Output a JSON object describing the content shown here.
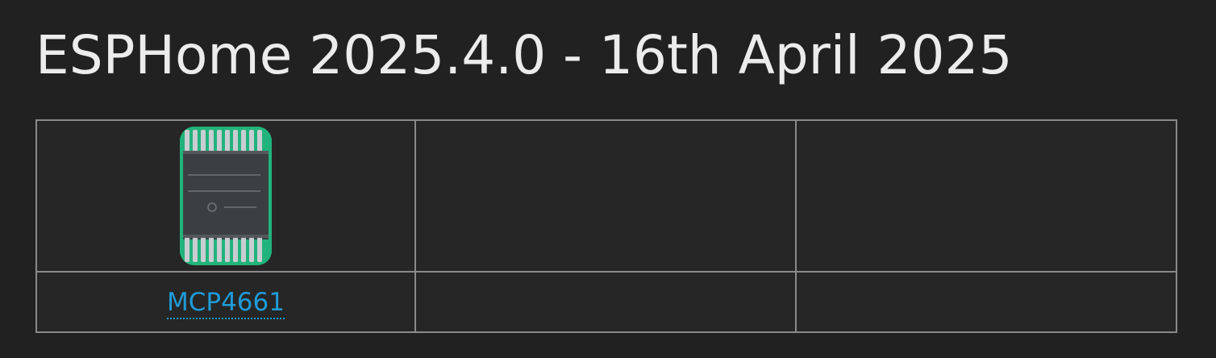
{
  "page": {
    "title": "ESPHome 2025.4.0 - 16th April 2025"
  },
  "components_table": {
    "rows": [
      {
        "cells": [
          {
            "image": "mcp4661-chip-photo"
          },
          {
            "image": ""
          },
          {
            "image": ""
          }
        ]
      },
      {
        "cells": [
          {
            "link_label": "MCP4661"
          },
          {
            "link_label": ""
          },
          {
            "link_label": ""
          }
        ]
      }
    ]
  },
  "colors": {
    "background": "#212121",
    "table_background": "#262626",
    "border": "#8a8a8a",
    "title_text": "#ececec",
    "link": "#1f9bd8",
    "chip_pcb": "#1fb07a"
  }
}
